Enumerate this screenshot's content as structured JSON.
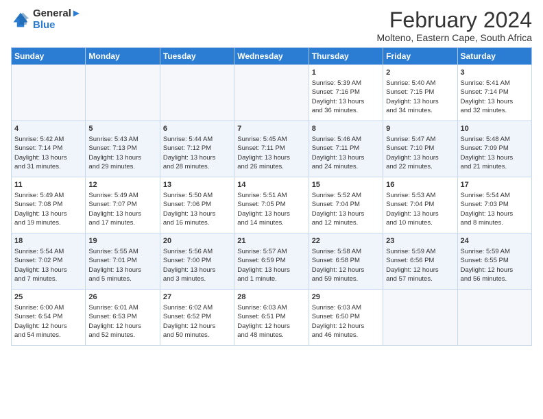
{
  "logo": {
    "line1": "General",
    "line2": "Blue"
  },
  "title": "February 2024",
  "subtitle": "Molteno, Eastern Cape, South Africa",
  "weekdays": [
    "Sunday",
    "Monday",
    "Tuesday",
    "Wednesday",
    "Thursday",
    "Friday",
    "Saturday"
  ],
  "weeks": [
    [
      {
        "day": "",
        "info": ""
      },
      {
        "day": "",
        "info": ""
      },
      {
        "day": "",
        "info": ""
      },
      {
        "day": "",
        "info": ""
      },
      {
        "day": "1",
        "info": "Sunrise: 5:39 AM\nSunset: 7:16 PM\nDaylight: 13 hours\nand 36 minutes."
      },
      {
        "day": "2",
        "info": "Sunrise: 5:40 AM\nSunset: 7:15 PM\nDaylight: 13 hours\nand 34 minutes."
      },
      {
        "day": "3",
        "info": "Sunrise: 5:41 AM\nSunset: 7:14 PM\nDaylight: 13 hours\nand 32 minutes."
      }
    ],
    [
      {
        "day": "4",
        "info": "Sunrise: 5:42 AM\nSunset: 7:14 PM\nDaylight: 13 hours\nand 31 minutes."
      },
      {
        "day": "5",
        "info": "Sunrise: 5:43 AM\nSunset: 7:13 PM\nDaylight: 13 hours\nand 29 minutes."
      },
      {
        "day": "6",
        "info": "Sunrise: 5:44 AM\nSunset: 7:12 PM\nDaylight: 13 hours\nand 28 minutes."
      },
      {
        "day": "7",
        "info": "Sunrise: 5:45 AM\nSunset: 7:11 PM\nDaylight: 13 hours\nand 26 minutes."
      },
      {
        "day": "8",
        "info": "Sunrise: 5:46 AM\nSunset: 7:11 PM\nDaylight: 13 hours\nand 24 minutes."
      },
      {
        "day": "9",
        "info": "Sunrise: 5:47 AM\nSunset: 7:10 PM\nDaylight: 13 hours\nand 22 minutes."
      },
      {
        "day": "10",
        "info": "Sunrise: 5:48 AM\nSunset: 7:09 PM\nDaylight: 13 hours\nand 21 minutes."
      }
    ],
    [
      {
        "day": "11",
        "info": "Sunrise: 5:49 AM\nSunset: 7:08 PM\nDaylight: 13 hours\nand 19 minutes."
      },
      {
        "day": "12",
        "info": "Sunrise: 5:49 AM\nSunset: 7:07 PM\nDaylight: 13 hours\nand 17 minutes."
      },
      {
        "day": "13",
        "info": "Sunrise: 5:50 AM\nSunset: 7:06 PM\nDaylight: 13 hours\nand 16 minutes."
      },
      {
        "day": "14",
        "info": "Sunrise: 5:51 AM\nSunset: 7:05 PM\nDaylight: 13 hours\nand 14 minutes."
      },
      {
        "day": "15",
        "info": "Sunrise: 5:52 AM\nSunset: 7:04 PM\nDaylight: 13 hours\nand 12 minutes."
      },
      {
        "day": "16",
        "info": "Sunrise: 5:53 AM\nSunset: 7:04 PM\nDaylight: 13 hours\nand 10 minutes."
      },
      {
        "day": "17",
        "info": "Sunrise: 5:54 AM\nSunset: 7:03 PM\nDaylight: 13 hours\nand 8 minutes."
      }
    ],
    [
      {
        "day": "18",
        "info": "Sunrise: 5:54 AM\nSunset: 7:02 PM\nDaylight: 13 hours\nand 7 minutes."
      },
      {
        "day": "19",
        "info": "Sunrise: 5:55 AM\nSunset: 7:01 PM\nDaylight: 13 hours\nand 5 minutes."
      },
      {
        "day": "20",
        "info": "Sunrise: 5:56 AM\nSunset: 7:00 PM\nDaylight: 13 hours\nand 3 minutes."
      },
      {
        "day": "21",
        "info": "Sunrise: 5:57 AM\nSunset: 6:59 PM\nDaylight: 13 hours\nand 1 minute."
      },
      {
        "day": "22",
        "info": "Sunrise: 5:58 AM\nSunset: 6:58 PM\nDaylight: 12 hours\nand 59 minutes."
      },
      {
        "day": "23",
        "info": "Sunrise: 5:59 AM\nSunset: 6:56 PM\nDaylight: 12 hours\nand 57 minutes."
      },
      {
        "day": "24",
        "info": "Sunrise: 5:59 AM\nSunset: 6:55 PM\nDaylight: 12 hours\nand 56 minutes."
      }
    ],
    [
      {
        "day": "25",
        "info": "Sunrise: 6:00 AM\nSunset: 6:54 PM\nDaylight: 12 hours\nand 54 minutes."
      },
      {
        "day": "26",
        "info": "Sunrise: 6:01 AM\nSunset: 6:53 PM\nDaylight: 12 hours\nand 52 minutes."
      },
      {
        "day": "27",
        "info": "Sunrise: 6:02 AM\nSunset: 6:52 PM\nDaylight: 12 hours\nand 50 minutes."
      },
      {
        "day": "28",
        "info": "Sunrise: 6:03 AM\nSunset: 6:51 PM\nDaylight: 12 hours\nand 48 minutes."
      },
      {
        "day": "29",
        "info": "Sunrise: 6:03 AM\nSunset: 6:50 PM\nDaylight: 12 hours\nand 46 minutes."
      },
      {
        "day": "",
        "info": ""
      },
      {
        "day": "",
        "info": ""
      }
    ]
  ]
}
